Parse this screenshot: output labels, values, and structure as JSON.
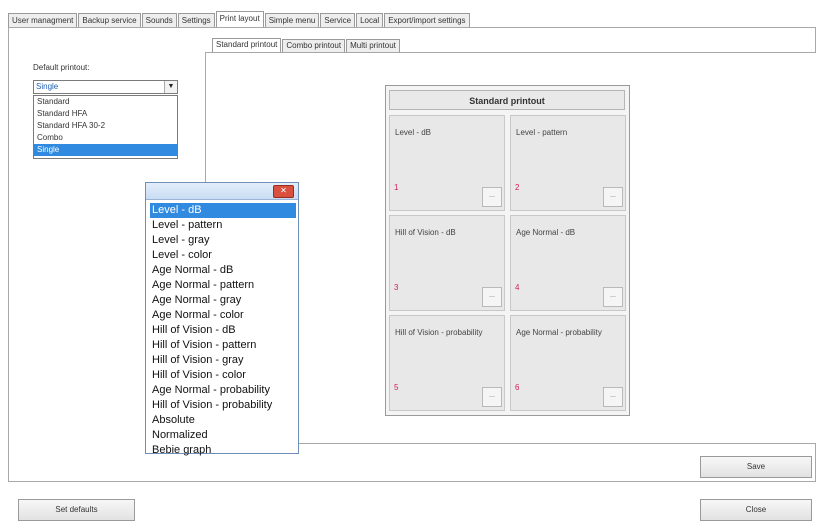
{
  "top_tabs": [
    {
      "label": "User managment",
      "active": false
    },
    {
      "label": "Backup service",
      "active": false
    },
    {
      "label": "Sounds",
      "active": false
    },
    {
      "label": "Settings",
      "active": false
    },
    {
      "label": "Print layout",
      "active": true
    },
    {
      "label": "Simple menu",
      "active": false
    },
    {
      "label": "Service",
      "active": false
    },
    {
      "label": "Local",
      "active": false
    },
    {
      "label": "Export/import settings",
      "active": false
    }
  ],
  "default_printout": {
    "label": "Default printout:",
    "value": "Single",
    "arrow": "▼",
    "options": [
      "Standard",
      "Standard HFA",
      "Standard HFA 30-2",
      "Combo",
      "Single"
    ],
    "selected": "Single"
  },
  "inner_tabs": [
    {
      "label": "Standard printout",
      "active": true
    },
    {
      "label": "Combo printout",
      "active": false
    },
    {
      "label": "Multi printout",
      "active": false
    }
  ],
  "layout": {
    "title": "Standard printout",
    "cells": [
      {
        "name": "Level - dB",
        "number": "1"
      },
      {
        "name": "Level - pattern",
        "number": "2"
      },
      {
        "name": "Hill of Vision - dB",
        "number": "3"
      },
      {
        "name": "Age Normal - dB",
        "number": "4"
      },
      {
        "name": "Hill of Vision - probability",
        "number": "5"
      },
      {
        "name": "Age Normal - probability",
        "number": "6"
      }
    ],
    "cell_button_label": "..."
  },
  "popup": {
    "close_symbol": "✕",
    "items": [
      "Level - dB",
      "Level - pattern",
      "Level - gray",
      "Level - color",
      "Age Normal - dB",
      "Age Normal - pattern",
      "Age Normal - gray",
      "Age Normal - color",
      "Hill of Vision - dB",
      "Hill of Vision - pattern",
      "Hill of Vision - gray",
      "Hill of Vision - color",
      "Age Normal - probability",
      "Hill of Vision - probability",
      "Absolute",
      "Normalized",
      "Bebie graph"
    ],
    "selected": "Level - dB"
  },
  "buttons": {
    "save": "Save",
    "set_defaults": "Set defaults",
    "close": "Close"
  },
  "colors": {
    "selection": "#2f8ae0",
    "cell_number": "#d21e5a",
    "close_button": "#d9503f"
  }
}
